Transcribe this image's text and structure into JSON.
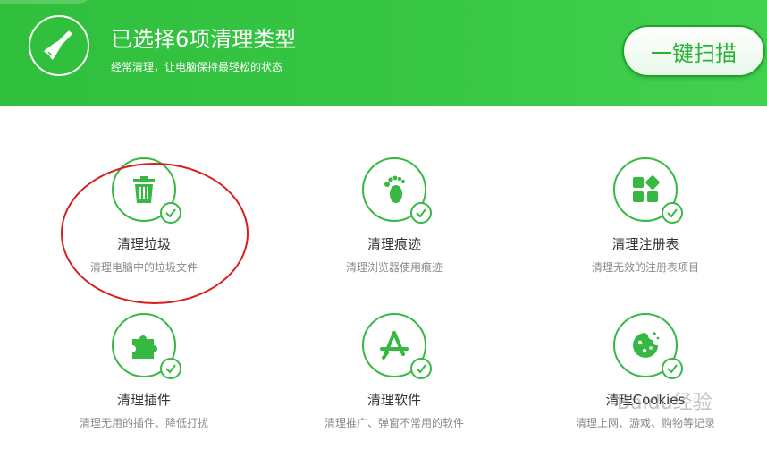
{
  "header": {
    "title": "已选择6项清理类型",
    "subtitle": "经常清理，让电脑保持最轻松的状态",
    "scan_button": "一键扫描"
  },
  "items": [
    {
      "title": "清理垃圾",
      "desc": "清理电脑中的垃圾文件",
      "icon": "trash-icon",
      "checked": true
    },
    {
      "title": "清理痕迹",
      "desc": "清理浏览器使用痕迹",
      "icon": "footprint-icon",
      "checked": true
    },
    {
      "title": "清理注册表",
      "desc": "清理无效的注册表项目",
      "icon": "registry-icon",
      "checked": true
    },
    {
      "title": "清理插件",
      "desc": "清理无用的插件、降低打扰",
      "icon": "puzzle-icon",
      "checked": true
    },
    {
      "title": "清理软件",
      "desc": "清理推广、弹窗不常用的软件",
      "icon": "app-icon",
      "checked": true
    },
    {
      "title": "清理Cookies",
      "desc": "清理上网、游戏、购物等记录",
      "icon": "cookie-icon",
      "checked": true
    }
  ],
  "watermark": "Baidu经验",
  "colors": {
    "accent": "#37b843",
    "header": "#38c745",
    "annotation": "#d81e1e"
  }
}
